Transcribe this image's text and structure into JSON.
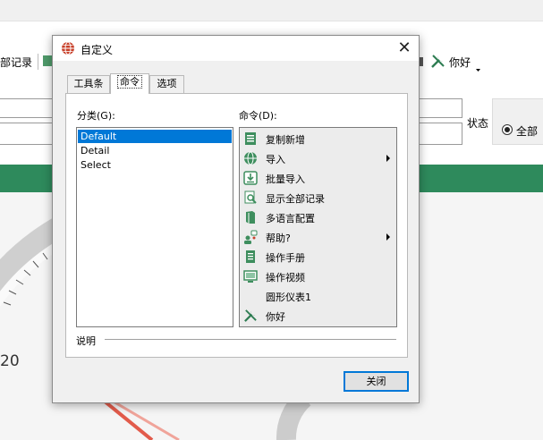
{
  "background": {
    "toolbar_left_text": "部记录",
    "toolbar_right_text": "你好",
    "status_label": "状态",
    "radio_all_label": "全部",
    "gauge_number": "20",
    "colors": {
      "green_bar": "#2e8a5c"
    }
  },
  "dialog": {
    "title": "自定义",
    "close_glyph": "✕",
    "tabs": [
      {
        "label": "工具条"
      },
      {
        "label": "命令"
      },
      {
        "label": "选项"
      }
    ],
    "categories_label": "分类(G):",
    "commands_label": "命令(D):",
    "categories": [
      "Default",
      "Detail",
      "Select"
    ],
    "selected_category": "Default",
    "commands": [
      {
        "label": "复制新增",
        "icon": "document-copy-icon",
        "submenu": false
      },
      {
        "label": "导入",
        "icon": "globe-icon",
        "submenu": true
      },
      {
        "label": "批量导入",
        "icon": "download-icon",
        "submenu": false
      },
      {
        "label": "显示全部记录",
        "icon": "search-document-icon",
        "submenu": false
      },
      {
        "label": "多语言配置",
        "icon": "book-icon",
        "submenu": false
      },
      {
        "label": "帮助?",
        "icon": "help-users-icon",
        "submenu": true
      },
      {
        "label": "操作手册",
        "icon": "manual-icon",
        "submenu": false
      },
      {
        "label": "操作视频",
        "icon": "monitor-icon",
        "submenu": false
      },
      {
        "label": "圆形仪表1",
        "icon": "",
        "submenu": false
      },
      {
        "label": "你好",
        "icon": "tools-icon",
        "submenu": false
      }
    ],
    "description_label": "说明",
    "close_button": "关闭",
    "colors": {
      "selection": "#0078d7",
      "accent": "#0078d7"
    }
  }
}
